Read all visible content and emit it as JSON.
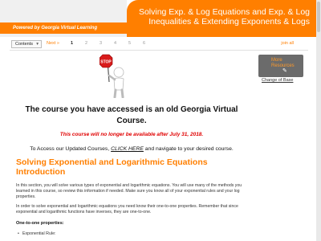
{
  "header": {
    "brand": "Powered by Georgia Virtual Learning",
    "title": "Solving Exp. & Log Equations and Exp. & Log Inequalities & Extending Exponents & Logs"
  },
  "nav": {
    "contents_label": "Contents",
    "next_label": "Next »",
    "pages": [
      "1",
      "2",
      "3",
      "4",
      "5",
      "6"
    ],
    "active_page": "1",
    "join_all": "join all"
  },
  "sidebar": {
    "more_resources": "More Resources",
    "change_base": "Change of Base"
  },
  "main": {
    "old_title": "The course you have accessed is an old Georgia Virtual Course.",
    "notice": "This course will no longer be available after July 31, 2018.",
    "access_prefix": "To Access our Updated Courses,",
    "access_link": "CLICK HERE",
    "access_suffix": "and navigate to your desired course.",
    "section_title": "Solving Exponential and Logarithmic Equations Introduction",
    "para1": "In this section, you will solve various types of exponential and logarithmic equations. You will use many of the methods you learned in this course, so review this information if needed. Make sure you know all of your exponential rules and your log properties.",
    "para2": "In order to solve exponential and logarithmic equations you need know their one-to-one properties. Remember that since exponential and logarithmic functions have inverses, they are one-to-one.",
    "subhead": "One-to-one properties:",
    "bullet1": "Exponential Rule:"
  },
  "colors": {
    "accent": "#ff7f00",
    "notice": "#e00000",
    "sidebar_box": "#6b6b6b"
  }
}
